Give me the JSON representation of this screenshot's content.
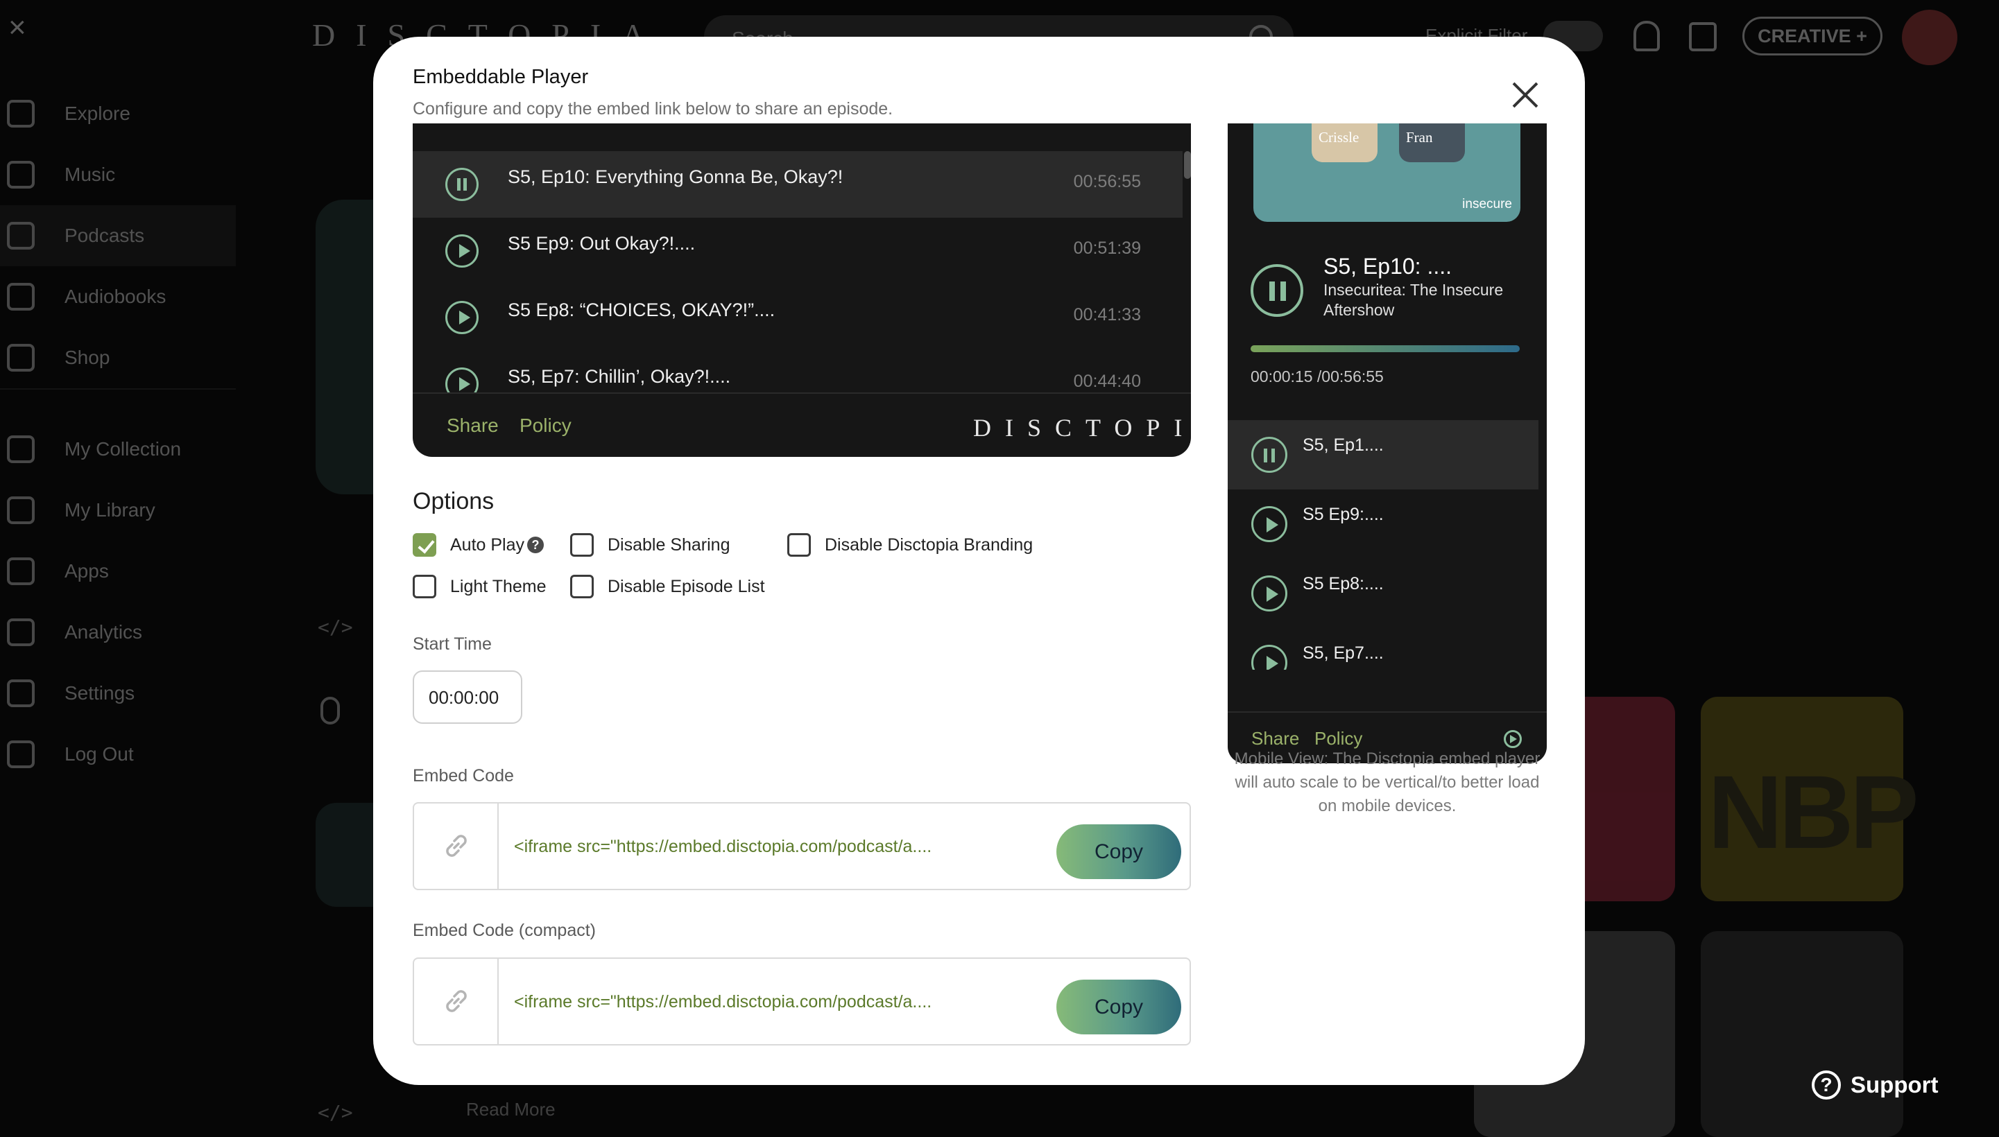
{
  "background": {
    "logo": "DISCTOPIA",
    "search_placeholder": "Search",
    "explicit_filter": "Explicit Filter",
    "creative_button": "CREATIVE +",
    "sidebar": {
      "items": [
        {
          "label": "Explore",
          "icon": "home-icon"
        },
        {
          "label": "Music",
          "icon": "music-note-icon"
        },
        {
          "label": "Podcasts",
          "icon": "microphone-icon"
        },
        {
          "label": "Audiobooks",
          "icon": "book-play-icon"
        },
        {
          "label": "Shop",
          "icon": "shopping-bag-icon"
        }
      ],
      "items2": [
        {
          "label": "My Collection",
          "icon": "heart-icon"
        },
        {
          "label": "My Library",
          "icon": "layers-icon"
        },
        {
          "label": "Apps",
          "icon": "grid-icon"
        },
        {
          "label": "Analytics",
          "icon": "pie-chart-icon"
        },
        {
          "label": "Settings",
          "icon": "gear-icon"
        },
        {
          "label": "Log Out",
          "icon": "logout-icon"
        }
      ]
    },
    "tile_text": "NBP",
    "read_more": "Read More"
  },
  "support": "Support",
  "modal": {
    "title": "Embeddable Player",
    "subtitle": "Configure and copy the embed link below to share an episode.",
    "desktop_preview": {
      "episodes": [
        {
          "title": "S5, Ep10: Everything Gonna Be, Okay?!",
          "duration": "00:56:55",
          "playing": true
        },
        {
          "title": "S5 Ep9: Out Okay?!....",
          "duration": "00:51:39",
          "playing": false
        },
        {
          "title": "S5 Ep8: “CHOICES, OKAY?!”....",
          "duration": "00:41:33",
          "playing": false
        },
        {
          "title": "S5, Ep7: Chillin’, Okay?!....",
          "duration": "00:44:40",
          "playing": false
        }
      ],
      "share": "Share",
      "policy": "Policy",
      "brand": "DISCTOPIA"
    },
    "options": {
      "title": "Options",
      "auto_play": "Auto Play",
      "auto_play_help": "?",
      "disable_sharing": "Disable Sharing",
      "disable_branding": "Disable Disctopia Branding",
      "light_theme": "Light Theme",
      "disable_episode_list": "Disable Episode List"
    },
    "start_time": {
      "label": "Start Time",
      "value": "00:00:00"
    },
    "embed_code": {
      "label": "Embed Code",
      "value": "<iframe src=\"https://embed.disctopia.com/podcast/a....",
      "copy": "Copy"
    },
    "embed_code_compact": {
      "label": "Embed Code (compact)",
      "value": "<iframe src=\"https://embed.disctopia.com/podcast/a....",
      "copy": "Copy"
    },
    "mobile_preview": {
      "cover_mug1": "Crissle",
      "cover_mug2": "Fran",
      "cover_brand": "insecure",
      "now_title": "S5, Ep10: ....",
      "now_show": "Insecuritea: The Insecure Aftershow",
      "time": "00:00:15 /00:56:55",
      "progress": 0.0044,
      "episodes": [
        {
          "title": "S5, Ep1....",
          "playing": true
        },
        {
          "title": "S5 Ep9:....",
          "playing": false
        },
        {
          "title": "S5 Ep8:....",
          "playing": false
        },
        {
          "title": "S5, Ep7....",
          "playing": false
        }
      ],
      "share": "Share",
      "policy": "Policy",
      "note": "Mobile View: The Disctopia embed player will auto scale to be vertical/to better load on mobile devices."
    }
  }
}
